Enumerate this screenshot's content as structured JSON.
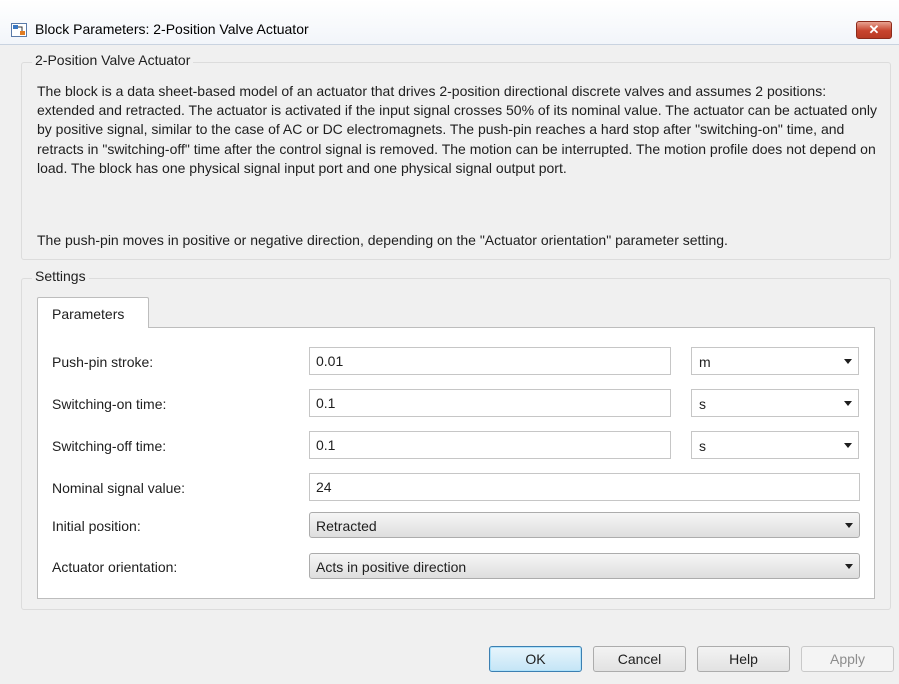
{
  "window": {
    "title": "Block Parameters: 2-Position Valve Actuator",
    "close_label": "✕"
  },
  "block": {
    "name": "2-Position Valve Actuator",
    "description_1": "The block is a data sheet-based model of an actuator that drives 2-position directional discrete valves and assumes 2 positions: extended and retracted. The actuator is activated if the input signal crosses 50% of its nominal value. The actuator can be actuated only by positive signal, similar to the case of AC or DC electromagnets. The push-pin reaches a hard stop after \"switching-on\" time, and retracts in \"switching-off\" time after the control signal is removed. The motion can be interrupted. The motion profile does not depend on load. The block has one physical signal input port and one physical signal output port.",
    "description_2": "The push-pin moves in positive or negative direction, depending on the \"Actuator orientation\" parameter setting."
  },
  "settings": {
    "caption": "Settings",
    "tab_label": "Parameters",
    "params": {
      "stroke": {
        "label": "Push-pin stroke:",
        "value": "0.01",
        "unit": "m"
      },
      "on_time": {
        "label": "Switching-on time:",
        "value": "0.1",
        "unit": "s"
      },
      "off_time": {
        "label": "Switching-off time:",
        "value": "0.1",
        "unit": "s"
      },
      "nominal": {
        "label": "Nominal signal value:",
        "value": "24"
      },
      "initial_position": {
        "label": "Initial position:",
        "selected": "Retracted"
      },
      "orientation": {
        "label": "Actuator orientation:",
        "selected": "Acts in positive direction"
      }
    }
  },
  "buttons": {
    "ok": "OK",
    "cancel": "Cancel",
    "help": "Help",
    "apply": "Apply"
  },
  "colors": {
    "close_button": "#c7432d",
    "ok_border": "#3c7fb1",
    "window_bg": "#f0f0f0"
  }
}
